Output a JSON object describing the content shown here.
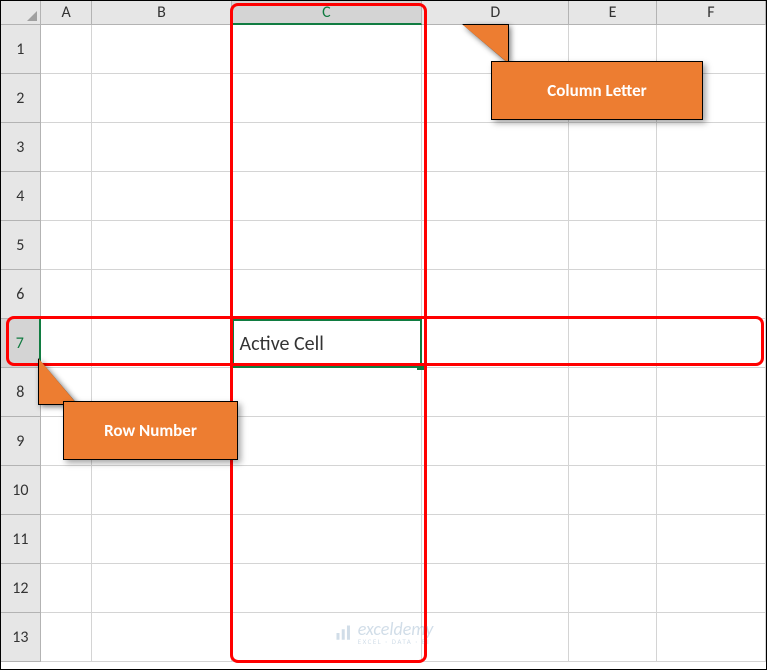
{
  "columns": [
    "A",
    "B",
    "C",
    "D",
    "E",
    "F"
  ],
  "rows": [
    "1",
    "2",
    "3",
    "4",
    "5",
    "6",
    "7",
    "8",
    "9",
    "10",
    "11",
    "12",
    "13"
  ],
  "active_column_index": 2,
  "active_row_index": 6,
  "active_cell_value": "Active Cell",
  "callouts": {
    "column": "Column Letter",
    "row": "Row Number"
  },
  "watermark": {
    "main": "exceldemy",
    "sub": "EXCEL · DATA · BI"
  }
}
